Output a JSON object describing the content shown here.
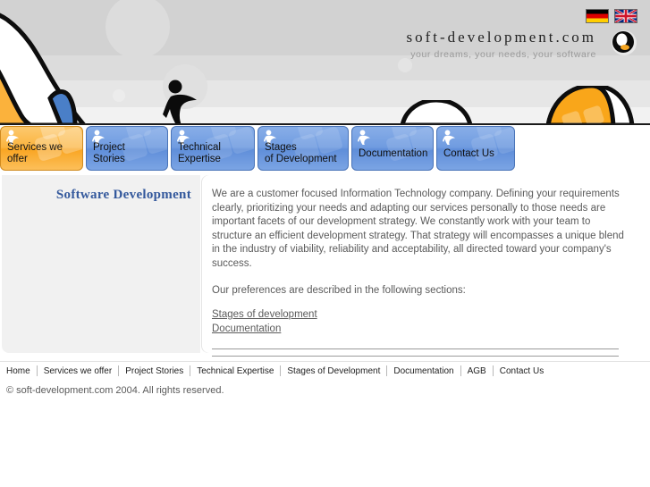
{
  "header": {
    "site_title": "soft-development.com",
    "tagline": "your dreams, your needs, your software",
    "logo_icon": "yin-yang-sphere-logo",
    "banner_person_icon": "running-person-icon",
    "flags": [
      {
        "name": "german-flag",
        "label": "Deutsch",
        "colors": [
          "#000000",
          "#dd0000",
          "#ffce00"
        ]
      },
      {
        "name": "uk-flag",
        "label": "English",
        "colors": [
          "#00247d",
          "#ffffff",
          "#cf142b"
        ]
      }
    ]
  },
  "nav": {
    "tabs": [
      {
        "label_line1": "Services we",
        "label_line2": "offer",
        "active": true,
        "icon": "person-icon"
      },
      {
        "label_line1": "Project",
        "label_line2": "Stories",
        "active": false,
        "icon": "person-icon"
      },
      {
        "label_line1": "Technical",
        "label_line2": "Expertise",
        "active": false,
        "icon": "person-icon"
      },
      {
        "label_line1": "Stages",
        "label_line2": "of Development",
        "active": false,
        "icon": "person-icon"
      },
      {
        "label_line1": "Documentation",
        "label_line2": "",
        "active": false,
        "icon": "person-icon"
      },
      {
        "label_line1": "Contact Us",
        "label_line2": "",
        "active": false,
        "icon": "person-icon"
      }
    ]
  },
  "main": {
    "page_title": "Software Development",
    "intro_paragraph": "We are a customer focused Information Technology company. Defining your requirements clearly, prioritizing your needs and adapting our services personally to those needs are important facets of our development strategy. We constantly work with your team to structure an efficient development strategy. That strategy will encompasses a unique blend in the industry of viability, reliability and acceptability, all directed toward your company's success.",
    "preferences_line": "Our preferences are described in the following sections:",
    "links": [
      {
        "label": "Stages of development"
      },
      {
        "label": "Documentation"
      }
    ]
  },
  "footer": {
    "links": [
      {
        "label": "Home"
      },
      {
        "label": "Services we offer"
      },
      {
        "label": "Project Stories"
      },
      {
        "label": "Technical Expertise"
      },
      {
        "label": "Stages of Development"
      },
      {
        "label": "Documentation"
      },
      {
        "label": "AGB"
      },
      {
        "label": "Contact Us"
      }
    ],
    "copyright": "©  soft-development.com 2004. All rights reserved."
  },
  "colors": {
    "accent_orange": "#fbb23c",
    "tab_blue": "#6f9be0",
    "title_blue": "#33589c",
    "banner_gray": "#d2d2d2",
    "text_gray": "#5a5a5a"
  }
}
